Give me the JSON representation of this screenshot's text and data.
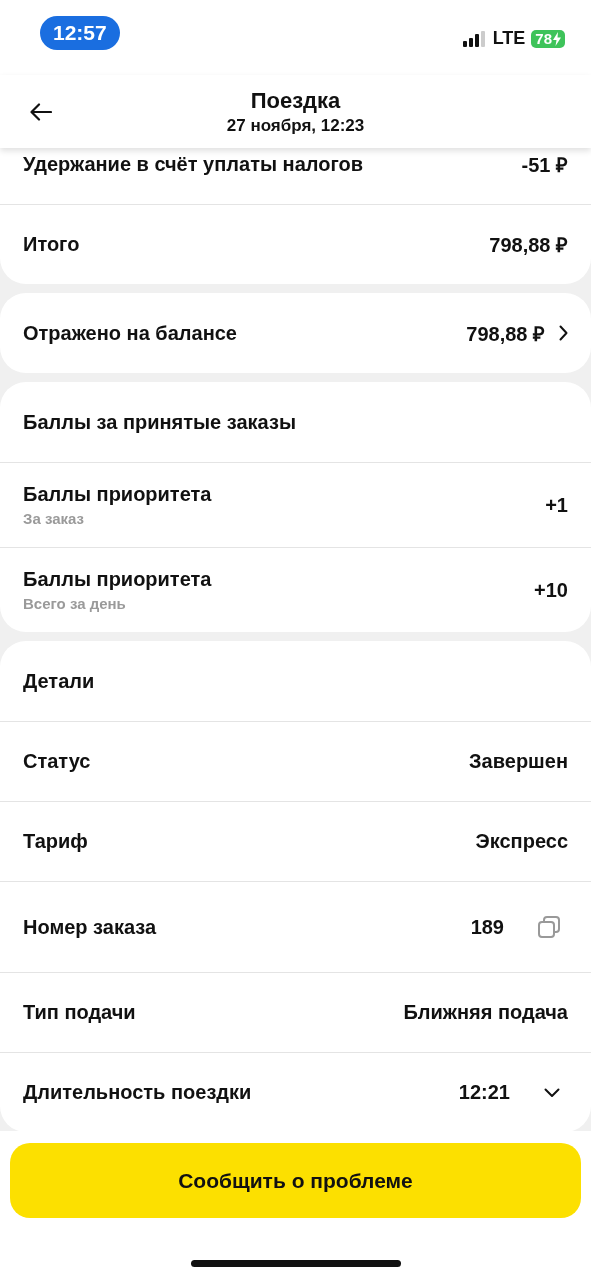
{
  "status_bar": {
    "time": "12:57",
    "network": "LTE",
    "battery": "78"
  },
  "header": {
    "title": "Поездка",
    "subtitle": "27 ноября, 12:23"
  },
  "sections": [
    {
      "rows": [
        {
          "kind": "value",
          "label": "Удержание в счёт уплаты налогов",
          "value": "-51 ₽"
        },
        {
          "kind": "value",
          "label": "Итого",
          "value": "798,88 ₽"
        }
      ]
    },
    {
      "rows": [
        {
          "kind": "link",
          "label": "Отражено на балансе",
          "value": "798,88 ₽"
        }
      ]
    },
    {
      "rows": [
        {
          "kind": "heading",
          "label": "Баллы за принятые заказы"
        },
        {
          "kind": "value",
          "label": "Баллы приоритета",
          "sublabel": "За заказ",
          "value": "+1"
        },
        {
          "kind": "value",
          "label": "Баллы приоритета",
          "sublabel": "Всего за день",
          "value": "+10"
        }
      ]
    },
    {
      "rows": [
        {
          "kind": "heading",
          "label": "Детали"
        },
        {
          "kind": "value",
          "label": "Статус",
          "value": "Завершен"
        },
        {
          "kind": "value",
          "label": "Тариф",
          "value": "Экспресс"
        },
        {
          "kind": "copy",
          "label": "Номер заказа",
          "value": "189"
        },
        {
          "kind": "value",
          "label": "Тип подачи",
          "value": "Ближняя подача"
        },
        {
          "kind": "expand",
          "label": "Длительность поездки",
          "value": "12:21",
          "expanded": false
        }
      ]
    }
  ],
  "button": {
    "label": "Сообщить о проблеме"
  }
}
